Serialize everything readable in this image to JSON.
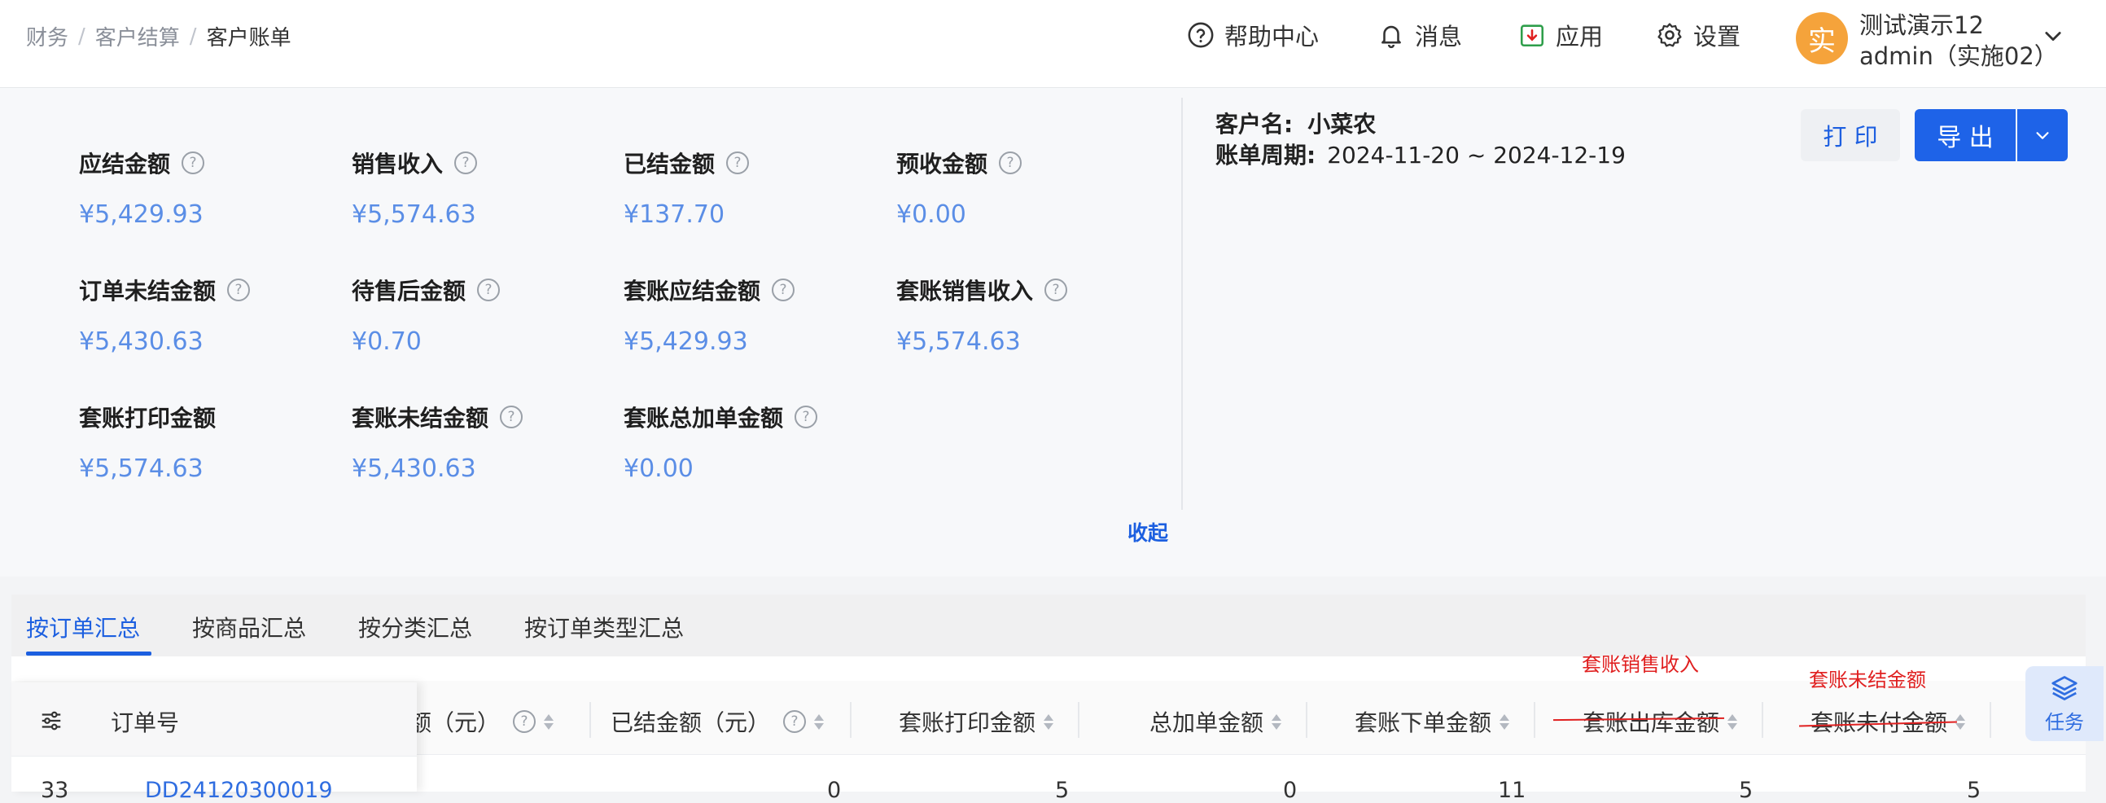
{
  "breadcrumb": [
    "财务",
    "客户结算",
    "客户账单"
  ],
  "header": {
    "help": "帮助中心",
    "messages": "消息",
    "apps": "应用",
    "settings": "设置",
    "avatar_char": "实",
    "user_line1": "测试演示12",
    "user_line2": "admin（实施02）"
  },
  "metrics": [
    {
      "label": "应结金额",
      "value": "¥5,429.93"
    },
    {
      "label": "销售收入",
      "value": "¥5,574.63"
    },
    {
      "label": "已结金额",
      "value": "¥137.70"
    },
    {
      "label": "预收金额",
      "value": "¥0.00"
    },
    {
      "label": "订单未结金额",
      "value": "¥5,430.63"
    },
    {
      "label": "待售后金额",
      "value": "¥0.70"
    },
    {
      "label": "套账应结金额",
      "value": "¥5,429.93"
    },
    {
      "label": "套账销售收入",
      "value": "¥5,574.63"
    },
    {
      "label": "套账打印金额",
      "value": "¥5,574.63"
    },
    {
      "label": "套账未结金额",
      "value": "¥5,430.63"
    },
    {
      "label": "套账总加单金额",
      "value": "¥0.00"
    }
  ],
  "collapse_label": "收起",
  "customer": {
    "name_label": "客户名:",
    "name": "小菜农",
    "period_label": "账单周期:",
    "period": "2024-11-20 ~ 2024-12-19"
  },
  "actions": {
    "print": "打 印",
    "export": "导 出"
  },
  "tabs": [
    "按订单汇总",
    "按商品汇总",
    "按分类汇总",
    "按订单类型汇总"
  ],
  "table": {
    "headers": {
      "order_no": "订单号",
      "amount": "金额（元）",
      "settled": "已结金额（元）",
      "print_amount": "套账打印金额",
      "add_amount": "总加单金额",
      "order_amount": "套账下单金额",
      "outbound_amount": "套账出库金额",
      "unpaid_amount": "套账未付金额"
    },
    "annotations": {
      "outbound": "套账销售收入",
      "unpaid": "套账未结金额"
    },
    "row": {
      "index": "33",
      "order_no": "DD24120300019",
      "settled": "0",
      "print_amount": "5",
      "add_amount": "0",
      "order_amount": "11",
      "outbound_amount": "5",
      "unpaid_amount": "5"
    }
  },
  "task_label": "任务",
  "colors": {
    "primary": "#1e63e8",
    "value_blue": "#5b8ee6",
    "annotation_red": "#e02020",
    "avatar": "#f5a33b"
  }
}
